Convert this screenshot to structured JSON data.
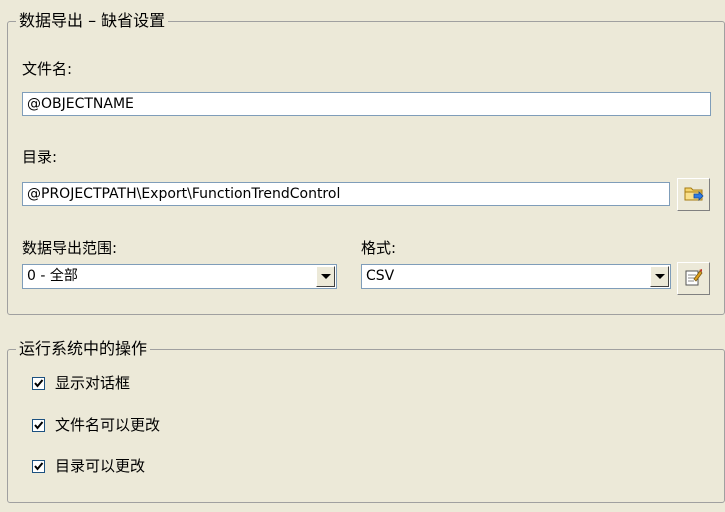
{
  "export_group": {
    "title": "数据导出 – 缺省设置",
    "filename_label": "文件名:",
    "filename_value": "@OBJECTNAME",
    "directory_label": "目录:",
    "directory_value": "@PROJECTPATH\\Export\\FunctionTrendControl",
    "range_label": "数据导出范围:",
    "range_value": "0 - 全部",
    "format_label": "格式:",
    "format_value": "CSV"
  },
  "runtime_group": {
    "title": "运行系统中的操作",
    "options": [
      {
        "label": "显示对话框",
        "checked": true
      },
      {
        "label": "文件名可以更改",
        "checked": true
      },
      {
        "label": "目录可以更改",
        "checked": true
      }
    ]
  },
  "icons": {
    "browse": "folder-browse-icon",
    "format_settings": "format-settings-icon",
    "dropdown": "chevron-down-icon",
    "check": "check-icon"
  }
}
